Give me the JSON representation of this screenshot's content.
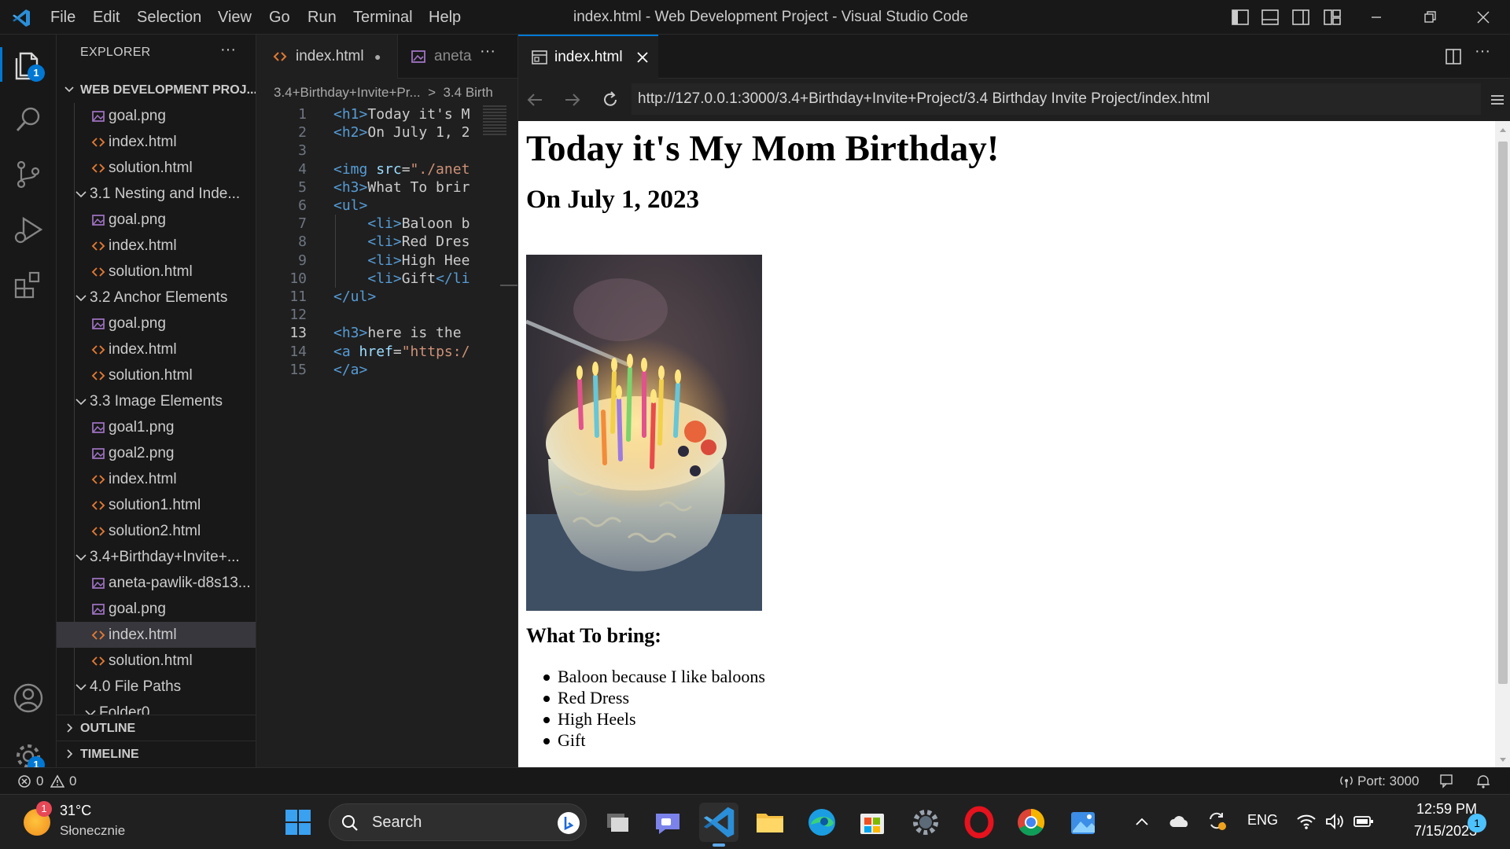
{
  "titlebar": {
    "menu": [
      "File",
      "Edit",
      "Selection",
      "View",
      "Go",
      "Run",
      "Terminal",
      "Help"
    ],
    "title": "index.html - Web Development Project - Visual Studio Code"
  },
  "activitybar": {
    "explorer_badge": "1",
    "settings_badge": "1"
  },
  "sidebar": {
    "title": "EXPLORER",
    "more": "···",
    "project": "WEB DEVELOPMENT PROJ...",
    "items": [
      {
        "label": "goal.png",
        "type": "image",
        "indent": 1
      },
      {
        "label": "index.html",
        "type": "html",
        "indent": 1
      },
      {
        "label": "solution.html",
        "type": "html",
        "indent": 1
      },
      {
        "label": "3.1 Nesting and Inde...",
        "type": "folder",
        "indent": 0
      },
      {
        "label": "goal.png",
        "type": "image",
        "indent": 1
      },
      {
        "label": "index.html",
        "type": "html",
        "indent": 1
      },
      {
        "label": "solution.html",
        "type": "html",
        "indent": 1
      },
      {
        "label": "3.2 Anchor Elements",
        "type": "folder",
        "indent": 0
      },
      {
        "label": "goal.png",
        "type": "image",
        "indent": 1
      },
      {
        "label": "index.html",
        "type": "html",
        "indent": 1
      },
      {
        "label": "solution.html",
        "type": "html",
        "indent": 1
      },
      {
        "label": "3.3 Image Elements",
        "type": "folder",
        "indent": 0
      },
      {
        "label": "goal1.png",
        "type": "image",
        "indent": 1
      },
      {
        "label": "goal2.png",
        "type": "image",
        "indent": 1
      },
      {
        "label": "index.html",
        "type": "html",
        "indent": 1
      },
      {
        "label": "solution1.html",
        "type": "html",
        "indent": 1
      },
      {
        "label": "solution2.html",
        "type": "html",
        "indent": 1
      },
      {
        "label": "3.4+Birthday+Invite+...",
        "type": "folder",
        "indent": 0
      },
      {
        "label": "aneta-pawlik-d8s13...",
        "type": "image",
        "indent": 1
      },
      {
        "label": "goal.png",
        "type": "image",
        "indent": 1
      },
      {
        "label": "index.html",
        "type": "html",
        "indent": 1,
        "selected": true
      },
      {
        "label": "solution.html",
        "type": "html",
        "indent": 1
      },
      {
        "label": "4.0 File Paths",
        "type": "folder",
        "indent": 0
      },
      {
        "label": "Folder0",
        "type": "folder",
        "indent": 1
      }
    ],
    "outline": "OUTLINE",
    "timeline": "TIMELINE"
  },
  "editor1": {
    "tabs": [
      {
        "label": "index.html",
        "dirty": "●"
      },
      {
        "label": "aneta"
      }
    ],
    "more": "···",
    "breadcrumb": "3.4+Birthday+Invite+Pr...  >  3.4 Birth",
    "active_line": 13,
    "lines": [
      {
        "n": "1",
        "parts": [
          [
            "tag",
            "<h1>"
          ],
          [
            "txt",
            "Today it's M"
          ]
        ]
      },
      {
        "n": "2",
        "parts": [
          [
            "tag",
            "<h2>"
          ],
          [
            "txt",
            "On July 1, 2"
          ]
        ]
      },
      {
        "n": "3",
        "parts": []
      },
      {
        "n": "4",
        "parts": [
          [
            "tag",
            "<img "
          ],
          [
            "attr",
            "src"
          ],
          [
            "txt",
            "="
          ],
          [
            "str",
            "\"./anet"
          ]
        ]
      },
      {
        "n": "5",
        "parts": [
          [
            "tag",
            "<h3>"
          ],
          [
            "txt",
            "What To brir"
          ]
        ]
      },
      {
        "n": "6",
        "parts": [
          [
            "tag",
            "<ul>"
          ]
        ]
      },
      {
        "n": "7",
        "parts": [
          [
            "txt",
            "    "
          ],
          [
            "tag",
            "<li>"
          ],
          [
            "txt",
            "Baloon b"
          ]
        ]
      },
      {
        "n": "8",
        "parts": [
          [
            "txt",
            "    "
          ],
          [
            "tag",
            "<li>"
          ],
          [
            "txt",
            "Red Dres"
          ]
        ]
      },
      {
        "n": "9",
        "parts": [
          [
            "txt",
            "    "
          ],
          [
            "tag",
            "<li>"
          ],
          [
            "txt",
            "High Hee"
          ]
        ]
      },
      {
        "n": "10",
        "parts": [
          [
            "txt",
            "    "
          ],
          [
            "tag",
            "<li>"
          ],
          [
            "txt",
            "Gift"
          ],
          [
            "tag",
            "</li"
          ]
        ]
      },
      {
        "n": "11",
        "parts": [
          [
            "tag",
            "</ul>"
          ]
        ]
      },
      {
        "n": "12",
        "parts": []
      },
      {
        "n": "13",
        "parts": [
          [
            "tag",
            "<h3>"
          ],
          [
            "txt",
            "here is the"
          ]
        ]
      },
      {
        "n": "14",
        "parts": [
          [
            "tag",
            "<a "
          ],
          [
            "attr",
            "href"
          ],
          [
            "txt",
            "="
          ],
          [
            "str",
            "\"https:/"
          ]
        ]
      },
      {
        "n": "15",
        "parts": [
          [
            "tag",
            "</a>"
          ]
        ]
      }
    ]
  },
  "editor2": {
    "tab_label": "index.html",
    "url": "http://127.0.0.1:3000/3.4+Birthday+Invite+Project/3.4 Birthday Invite Project/index.html",
    "page": {
      "h1": "Today it's My Mom Birthday!",
      "h2": "On July 1, 2023",
      "h3": "What To bring:",
      "list": [
        "Baloon because I like baloons",
        "Red Dress",
        "High Heels",
        "Gift"
      ]
    }
  },
  "statusbar": {
    "errors": "0",
    "warnings": "0",
    "port": "Port: 3000"
  },
  "taskbar": {
    "weather_badge": "1",
    "temperature": "31°C",
    "condition": "Słonecznie",
    "search": "Search",
    "lang": "ENG",
    "time": "12:59 PM",
    "date": "7/15/2023",
    "notif": "1"
  }
}
